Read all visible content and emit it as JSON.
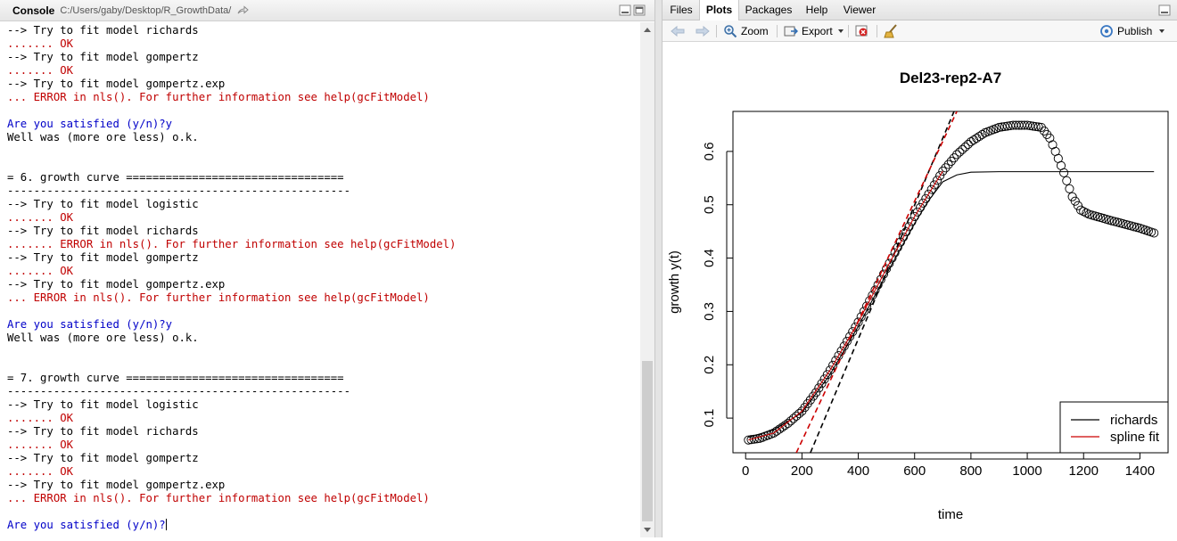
{
  "console": {
    "tab_label": "Console",
    "path": "C:/Users/gaby/Desktop/R_GrowthData/",
    "lines": [
      {
        "text": "--> Try to fit model richards",
        "color": "black"
      },
      {
        "text": "....... OK",
        "color": "red"
      },
      {
        "text": "--> Try to fit model gompertz",
        "color": "black"
      },
      {
        "text": "....... OK",
        "color": "red"
      },
      {
        "text": "--> Try to fit model gompertz.exp",
        "color": "black"
      },
      {
        "text": "... ERROR in nls(). For further information see help(gcFitModel)",
        "color": "red"
      },
      {
        "text": "",
        "color": "black"
      },
      {
        "text": "Are you satisfied (y/n)?y",
        "color": "blue"
      },
      {
        "text": "Well was (more ore less) o.k.",
        "color": "black"
      },
      {
        "text": "",
        "color": "black"
      },
      {
        "text": "",
        "color": "black"
      },
      {
        "text": "= 6. growth curve =================================",
        "color": "black"
      },
      {
        "text": "----------------------------------------------------",
        "color": "black"
      },
      {
        "text": "--> Try to fit model logistic",
        "color": "black"
      },
      {
        "text": "....... OK",
        "color": "red"
      },
      {
        "text": "--> Try to fit model richards",
        "color": "black"
      },
      {
        "text": "....... ERROR in nls(). For further information see help(gcFitModel)",
        "color": "red"
      },
      {
        "text": "--> Try to fit model gompertz",
        "color": "black"
      },
      {
        "text": "....... OK",
        "color": "red"
      },
      {
        "text": "--> Try to fit model gompertz.exp",
        "color": "black"
      },
      {
        "text": "... ERROR in nls(). For further information see help(gcFitModel)",
        "color": "red"
      },
      {
        "text": "",
        "color": "black"
      },
      {
        "text": "Are you satisfied (y/n)?y",
        "color": "blue"
      },
      {
        "text": "Well was (more ore less) o.k.",
        "color": "black"
      },
      {
        "text": "",
        "color": "black"
      },
      {
        "text": "",
        "color": "black"
      },
      {
        "text": "= 7. growth curve =================================",
        "color": "black"
      },
      {
        "text": "----------------------------------------------------",
        "color": "black"
      },
      {
        "text": "--> Try to fit model logistic",
        "color": "black"
      },
      {
        "text": "....... OK",
        "color": "red"
      },
      {
        "text": "--> Try to fit model richards",
        "color": "black"
      },
      {
        "text": "....... OK",
        "color": "red"
      },
      {
        "text": "--> Try to fit model gompertz",
        "color": "black"
      },
      {
        "text": "....... OK",
        "color": "red"
      },
      {
        "text": "--> Try to fit model gompertz.exp",
        "color": "black"
      },
      {
        "text": "... ERROR in nls(). For further information see help(gcFitModel)",
        "color": "red"
      },
      {
        "text": "",
        "color": "black"
      },
      {
        "text": "Are you satisfied (y/n)?",
        "color": "blue"
      }
    ],
    "colors": {
      "black": "#000000",
      "red": "#c00000",
      "blue": "#0000c8"
    }
  },
  "panel": {
    "tabs": [
      {
        "label": "Files",
        "active": false
      },
      {
        "label": "Plots",
        "active": true
      },
      {
        "label": "Packages",
        "active": false
      },
      {
        "label": "Help",
        "active": false
      },
      {
        "label": "Viewer",
        "active": false
      }
    ],
    "toolbar": {
      "zoom_label": "Zoom",
      "export_label": "Export",
      "publish_label": "Publish"
    }
  },
  "chart_data": {
    "type": "scatter",
    "title": "Del23-rep2-A7",
    "xlabel": "time",
    "ylabel": "growth y(t)",
    "xlim": [
      -45,
      1500
    ],
    "ylim": [
      0.035,
      0.675
    ],
    "xticks": [
      0,
      200,
      400,
      600,
      800,
      1000,
      1200,
      1400
    ],
    "yticks": [
      0.1,
      0.2,
      0.3,
      0.4,
      0.5,
      0.6
    ],
    "legend": {
      "position": "bottom-right",
      "entries": [
        {
          "name": "richards",
          "color": "#000000"
        },
        {
          "name": "spline fit",
          "color": "#cc0000"
        }
      ]
    },
    "data_points": {
      "x_start": 10,
      "x_end": 1450,
      "x_step": 10,
      "knots": [
        [
          10,
          0.059
        ],
        [
          50,
          0.062
        ],
        [
          100,
          0.072
        ],
        [
          150,
          0.09
        ],
        [
          200,
          0.113
        ],
        [
          250,
          0.148
        ],
        [
          300,
          0.19
        ],
        [
          350,
          0.235
        ],
        [
          400,
          0.28
        ],
        [
          450,
          0.33
        ],
        [
          500,
          0.38
        ],
        [
          550,
          0.43
        ],
        [
          600,
          0.478
        ],
        [
          650,
          0.52
        ],
        [
          700,
          0.563
        ],
        [
          750,
          0.594
        ],
        [
          800,
          0.618
        ],
        [
          850,
          0.635
        ],
        [
          900,
          0.645
        ],
        [
          950,
          0.649
        ],
        [
          1000,
          0.649
        ],
        [
          1050,
          0.645
        ],
        [
          1080,
          0.625
        ],
        [
          1100,
          0.6
        ],
        [
          1130,
          0.56
        ],
        [
          1160,
          0.515
        ],
        [
          1190,
          0.49
        ],
        [
          1220,
          0.482
        ],
        [
          1300,
          0.47
        ],
        [
          1400,
          0.456
        ],
        [
          1450,
          0.447
        ]
      ]
    },
    "series": [
      {
        "name": "richards",
        "color": "#000000",
        "style": "solid",
        "points": [
          [
            10,
            0.064
          ],
          [
            100,
            0.078
          ],
          [
            200,
            0.11
          ],
          [
            300,
            0.182
          ],
          [
            400,
            0.272
          ],
          [
            500,
            0.37
          ],
          [
            600,
            0.465
          ],
          [
            650,
            0.508
          ],
          [
            700,
            0.543
          ],
          [
            750,
            0.556
          ],
          [
            800,
            0.561
          ],
          [
            900,
            0.562
          ],
          [
            1450,
            0.562
          ]
        ]
      },
      {
        "name": "spline fit",
        "color": "#cc0000",
        "style": "solid",
        "points": [
          [
            10,
            0.059
          ],
          [
            100,
            0.072
          ],
          [
            200,
            0.113
          ],
          [
            300,
            0.19
          ],
          [
            400,
            0.28
          ],
          [
            500,
            0.38
          ],
          [
            600,
            0.478
          ],
          [
            700,
            0.563
          ]
        ]
      }
    ],
    "tangents": [
      {
        "color": "#000000",
        "style": "dashed",
        "x1": 230,
        "y1": 0.035,
        "x2": 740,
        "y2": 0.675
      },
      {
        "color": "#cc0000",
        "style": "dashed",
        "x1": 180,
        "y1": 0.035,
        "x2": 750,
        "y2": 0.675
      }
    ]
  }
}
